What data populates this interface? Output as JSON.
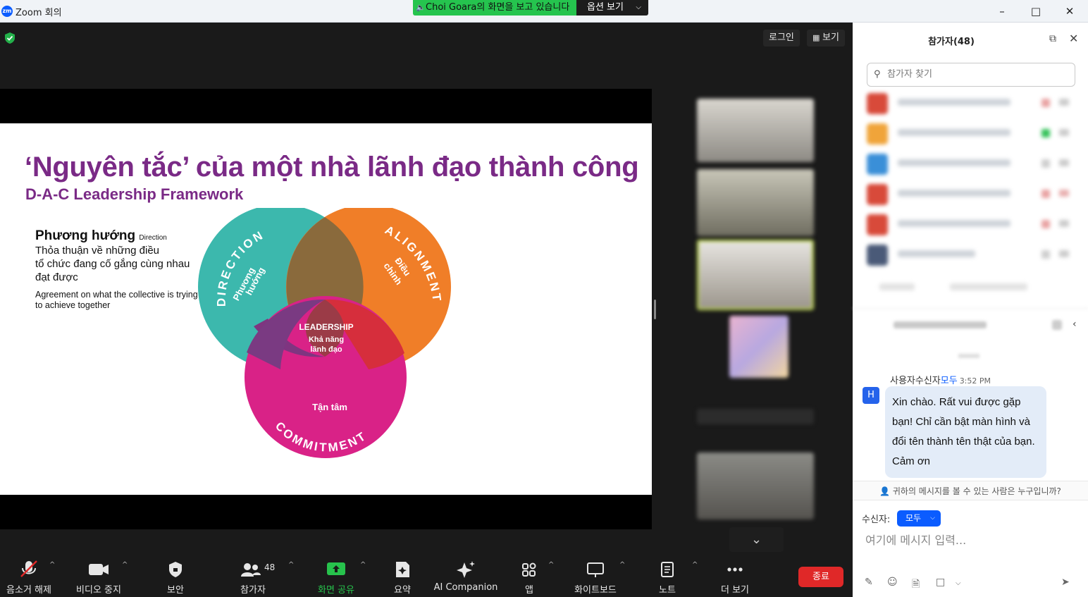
{
  "window": {
    "title": "Zoom 회의",
    "logo_text": "zm"
  },
  "share_banner": {
    "text": "Choi Goara의 화면을 보고 있습니다",
    "options_label": "옵션 보기"
  },
  "meeting_top": {
    "login_label": "로그인",
    "view_label": "보기"
  },
  "slide": {
    "title": "‘Nguyên tắc’ của một nhà lãnh đạo thành công",
    "subtitle": "D-A-C Leadership Framework",
    "direction": {
      "heading": "Phương hướng",
      "heading_small": "Direction",
      "vi_line1": "Thỏa thuận về những điều",
      "vi_line2": "tổ chức đang cố gắng cùng nhau",
      "vi_line3": "đạt được",
      "en_line1": "Agreement on what the collective is trying",
      "en_line2": "to achieve together"
    },
    "venn": {
      "direction_label": "DIRECTION",
      "direction_vi_1": "Phương",
      "direction_vi_2": "hướng",
      "alignment_label": "ALIGNMENT",
      "alignment_vi_1": "Điều",
      "alignment_vi_2": "chỉnh",
      "commitment_label": "COMMITMENT",
      "commitment_vi": "Tận tâm",
      "center_en": "LEADERSHIP",
      "center_vi_1": "Khả năng",
      "center_vi_2": "lãnh đạo",
      "colors": {
        "direction": "#3cb8ad",
        "alignment": "#f07e28",
        "commitment": "#d92287",
        "title": "#7a2a86"
      }
    }
  },
  "toolbar": {
    "unmute": "음소거 해제",
    "video_stop": "비디오 중지",
    "security": "보안",
    "participants": "참가자",
    "participant_count": "48",
    "share_screen": "화면 공유",
    "summary": "요약",
    "ai_companion": "AI Companion",
    "apps": "앱",
    "whiteboard": "화이트보드",
    "notes": "노트",
    "more": "더 보기",
    "end": "종료"
  },
  "panel": {
    "title": "참가자(48)",
    "search_placeholder": "참가자 찾기",
    "chat": {
      "sender": "사용자수신자",
      "recipient": "모두",
      "time": "3:52 PM",
      "avatar_letter": "H",
      "message": "Xin chào. Rất vui được gặp bạn! Chỉ cần bật màn hình và đổi tên thành tên thật của bạn. Cảm ơn",
      "who_can_see": "귀하의 메시지를 볼 수 있는 사람은 누구입니까?",
      "recipient_label": "수신자:",
      "recipient_value": "모두",
      "input_placeholder": "여기에 메시지 입력..."
    }
  }
}
